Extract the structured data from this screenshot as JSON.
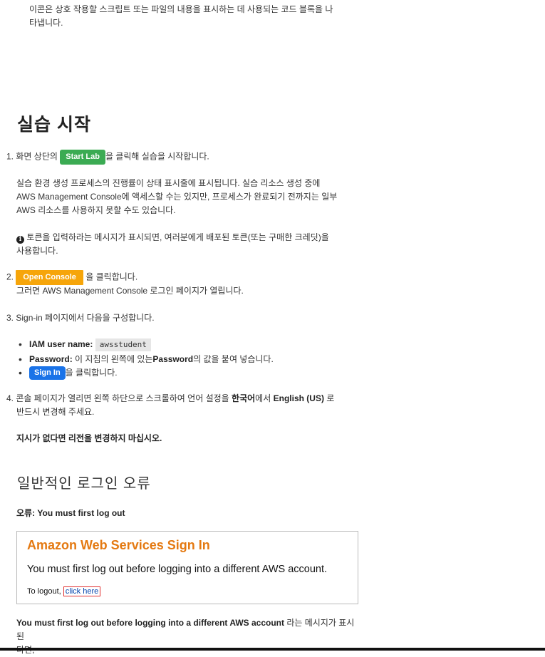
{
  "intro": {
    "line1": "이콘은 상호 작용할 스크립트 또는 파일의 내용을 표시하는 데 사용되는 코드 블록을 나",
    "line2": "타냅니다."
  },
  "section_title": "실습 시작",
  "step1": {
    "num": "1.",
    "prefix": "화면 상단의",
    "button": "Start Lab",
    "suffix": "을 클릭해 실습을 시작합니다.",
    "para_line1": "실습 환경 생성 프로세스의 진행률이 상태 표시줄에 표시됩니다. 실습 리소스 생성 중에",
    "para_line2": "AWS Management Console에 액세스할 수는 있지만, 프로세스가 완료되기 전까지는 일부",
    "para_line3": "AWS 리소스를 사용하지 못할 수도 있습니다.",
    "info_line1": "토큰을 입력하라는 메시지가 표시되면, 여러분에게 배포된 토큰(또는 구매한 크레딧)을",
    "info_line2": "사용합니다."
  },
  "step2": {
    "num": "2.",
    "button": "Open Console",
    "suffix": "을 클릭합니다.",
    "line2": "그러면 AWS Management Console 로그인 페이지가 열립니다."
  },
  "step3": {
    "num": "3.",
    "text": "Sign-in 페이지에서 다음을 구성합니다.",
    "iam_label": "IAM user name:",
    "iam_value": "awsstudent",
    "password_label": "Password:",
    "password_text1": "이 지침의 왼쪽에 있는",
    "password_bold": "Password",
    "password_text2": "의 값을 붙여 넣습니다.",
    "signin_button": "Sign In",
    "signin_suffix": "을 클릭합니다."
  },
  "step4": {
    "num": "4.",
    "text1": "콘솔 페이지가 열리면 왼쪽 하단으로 스크롤하여 언어 설정을",
    "bold1": "한국어",
    "text2": "에서",
    "bold2": "English (US)",
    "text3": "로",
    "line2": "반드시 변경해 주세요.",
    "warning": "지시가 없다면 리전을 변경하지 마십시오."
  },
  "errors": {
    "title": "일반적인 로그인 오류",
    "error_label": "오류: You must first log out",
    "box_title": "Amazon Web Services Sign In",
    "box_message": "You must first log out before logging into a different AWS account.",
    "box_logout_prefix": "To logout,",
    "box_logout_link": "click here",
    "bottom_bold": "You must first log out before logging into a different AWS account",
    "bottom_text": "라는 메시지가 표시된",
    "bottom_line2": "다면,"
  }
}
